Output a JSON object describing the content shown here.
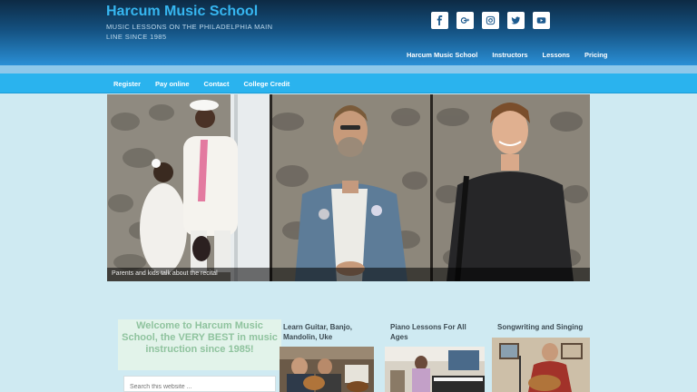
{
  "site": {
    "title": "Harcum Music School",
    "tagline": "MUSIC LESSONS ON THE PHILADELPHIA MAIN LINE SINCE 1985"
  },
  "social_icons": [
    "facebook-icon",
    "google-plus-icon",
    "instagram-icon",
    "twitter-icon",
    "youtube-icon"
  ],
  "primary_nav": [
    {
      "label": "Harcum Music School"
    },
    {
      "label": "Instructors"
    },
    {
      "label": "Lessons"
    },
    {
      "label": "Pricing"
    }
  ],
  "secondary_nav": [
    {
      "label": "Register"
    },
    {
      "label": "Pay online"
    },
    {
      "label": "Contact"
    },
    {
      "label": "College Credit"
    }
  ],
  "hero": {
    "caption": "Parents and kids talk about the recital"
  },
  "welcome": {
    "text": "Welcome to Harcum Music School, the VERY BEST in music instruction since 1985!"
  },
  "search": {
    "placeholder": "Search this website ..."
  },
  "columns": [
    {
      "title": "Learn Guitar, Banjo, Mandolin, Uke"
    },
    {
      "title": "Piano Lessons For All Ages"
    },
    {
      "title": "Songwriting and Singing"
    }
  ],
  "colors": {
    "header_dark": "#0d2a44",
    "accent": "#2ab3ee",
    "title": "#36b6f0",
    "background": "#cfeaf2"
  }
}
